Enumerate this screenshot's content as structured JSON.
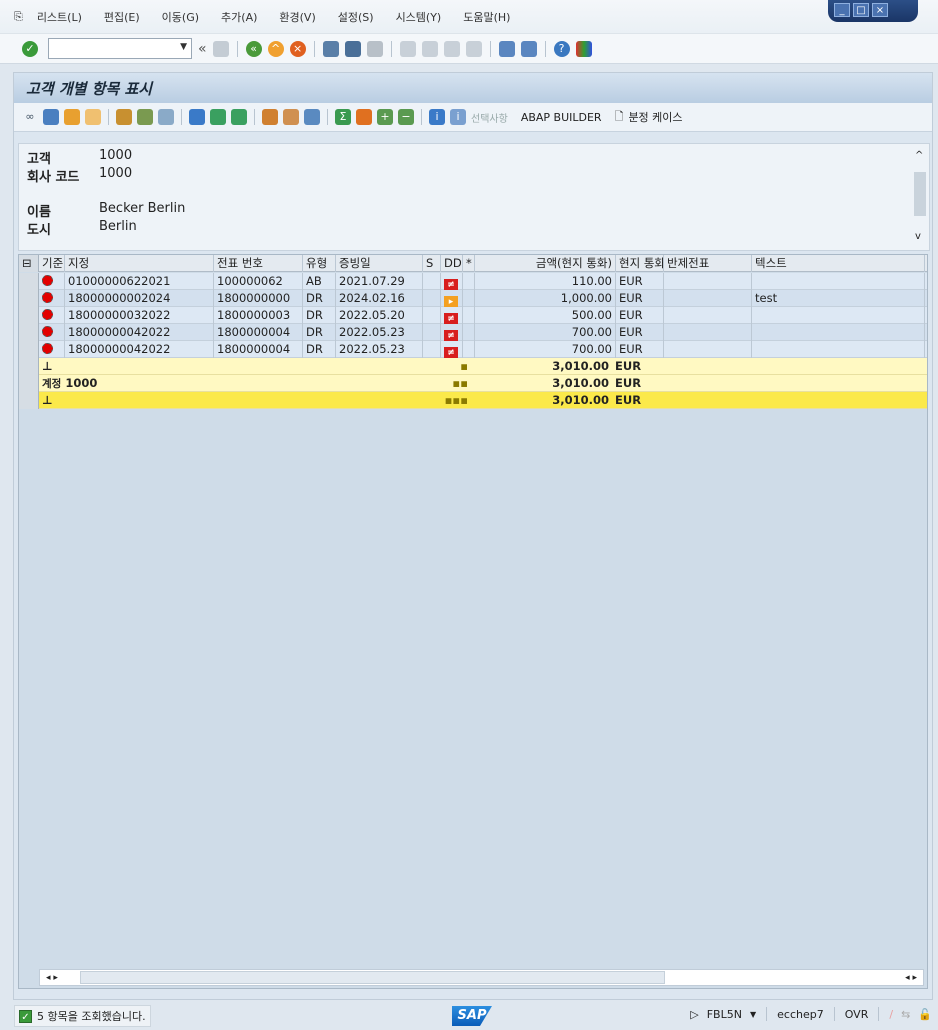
{
  "menu": [
    "리스트(L)",
    "편집(E)",
    "이동(G)",
    "추가(A)",
    "환경(V)",
    "설정(S)",
    "시스템(Y)",
    "도움말(H)"
  ],
  "window_controls": [
    "_",
    "□",
    "×"
  ],
  "command_field": {
    "value": ""
  },
  "title": "고객 개별 항목 표시",
  "app_toolbar": {
    "selection_label": "선택사항",
    "abap_builder": "ABAP BUILDER",
    "split_case": "분정 케이스"
  },
  "header": {
    "customer_label": "고객",
    "customer": "1000",
    "company_label": "회사 코드",
    "company": "1000",
    "name_label": "이름",
    "name": "Becker Berlin",
    "city_label": "도시",
    "city": "Berlin"
  },
  "grid": {
    "columns": [
      "기준",
      "지정",
      "전표 번호",
      "유형",
      "증빙일",
      "S",
      "DD",
      "*",
      "금액(현지 통화)",
      "현지 통화",
      "반제전표",
      "텍스트"
    ],
    "rows": [
      {
        "assignment": "01000000622021",
        "doc": "100000062",
        "type": "AB",
        "date": "2021.07.29",
        "dd": "red",
        "amount": "110.00",
        "cur": "EUR",
        "clearing": "",
        "text": ""
      },
      {
        "assignment": "18000000002024",
        "doc": "1800000000",
        "type": "DR",
        "date": "2024.02.16",
        "dd": "orange",
        "amount": "1,000.00",
        "cur": "EUR",
        "clearing": "",
        "text": "test"
      },
      {
        "assignment": "18000000032022",
        "doc": "1800000003",
        "type": "DR",
        "date": "2022.05.20",
        "dd": "red",
        "amount": "500.00",
        "cur": "EUR",
        "clearing": "",
        "text": ""
      },
      {
        "assignment": "18000000042022",
        "doc": "1800000004",
        "type": "DR",
        "date": "2022.05.23",
        "dd": "red",
        "amount": "700.00",
        "cur": "EUR",
        "clearing": "",
        "text": ""
      },
      {
        "assignment": "18000000042022",
        "doc": "1800000004",
        "type": "DR",
        "date": "2022.05.23",
        "dd": "red",
        "amount": "700.00",
        "cur": "EUR",
        "clearing": "",
        "text": ""
      }
    ],
    "subtotal": {
      "level": "▪",
      "amount": "3,010.00",
      "cur": "EUR"
    },
    "account_total": {
      "label": "계정",
      "account": "1000",
      "level": "▪▪",
      "amount": "3,010.00",
      "cur": "EUR"
    },
    "grand_total": {
      "level": "▪▪▪",
      "amount": "3,010.00",
      "cur": "EUR"
    }
  },
  "status": {
    "message": "5 항목을 조회했습니다.",
    "logo": "SAP",
    "transaction": "FBL5N",
    "system": "ecchep7",
    "mode": "OVR"
  }
}
